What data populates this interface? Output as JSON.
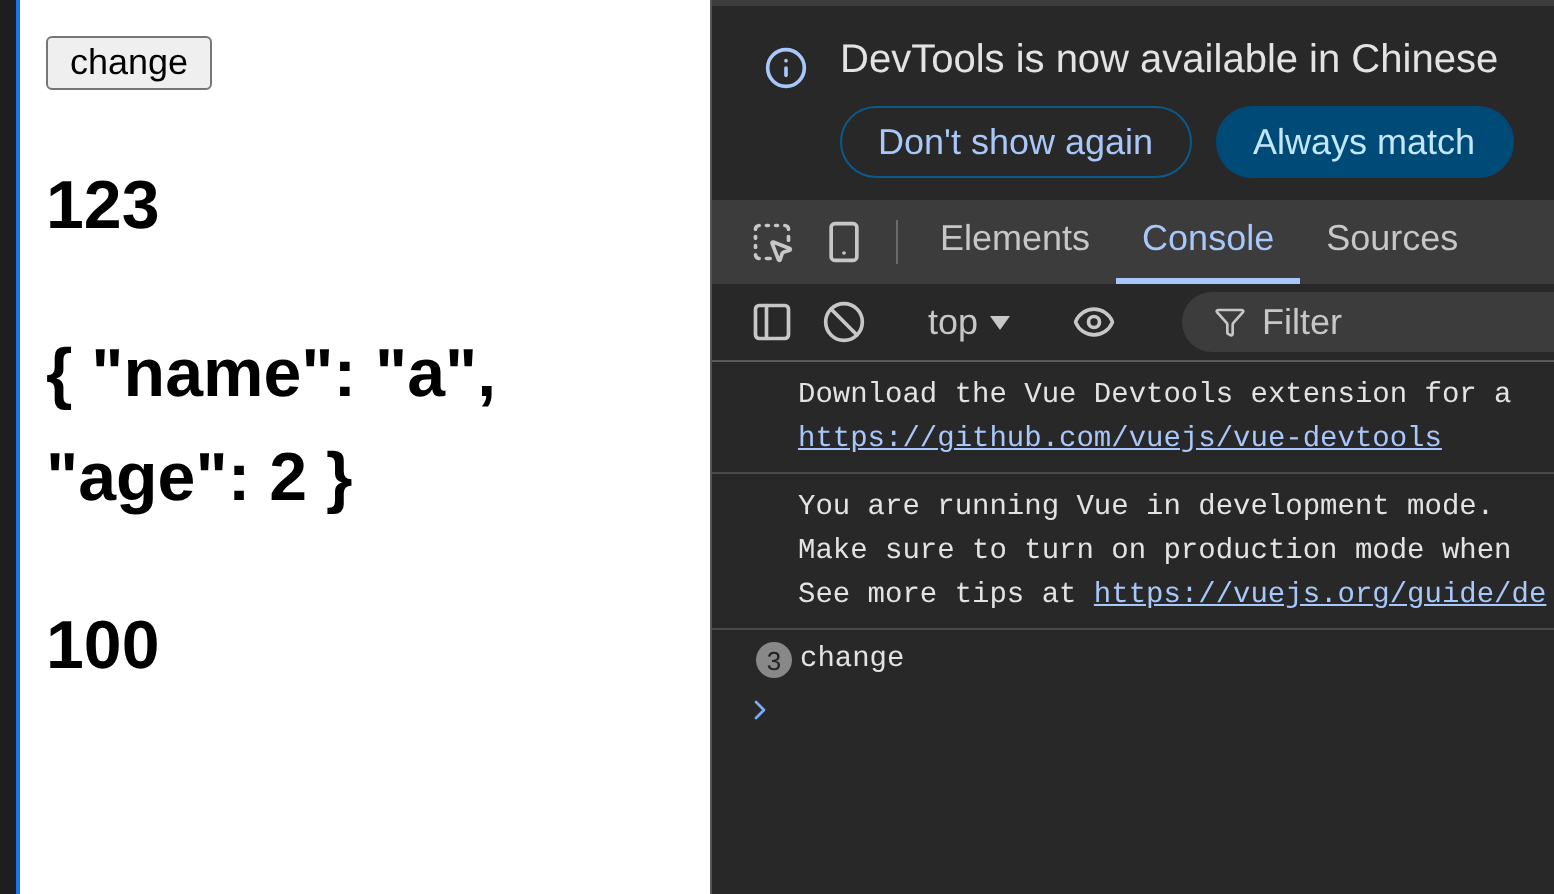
{
  "page": {
    "button": "change",
    "outputs": [
      "123",
      "{ \"name\": \"a\", \"age\": 2 }",
      "100"
    ]
  },
  "devtools": {
    "banner": {
      "text": "DevTools is now available in Chinese",
      "buttons": [
        {
          "label": "Don't show again",
          "kind": "outline"
        },
        {
          "label": "Always match",
          "kind": "primary"
        }
      ]
    },
    "tabs": [
      {
        "label": "Elements",
        "selected": false
      },
      {
        "label": "Console",
        "selected": true
      },
      {
        "label": "Sources",
        "selected": false
      }
    ],
    "toolbar": {
      "context": "top",
      "filter": {
        "placeholder": "Filter"
      }
    },
    "messages": [
      {
        "kind": "log",
        "lines": [
          {
            "text": "Download the Vue Devtools extension for a"
          },
          {
            "link": "https://github.com/vuejs/vue-devtools"
          }
        ]
      },
      {
        "kind": "log",
        "lines": [
          {
            "text": "You are running Vue in development mode."
          },
          {
            "text": "Make sure to turn on production mode when"
          },
          {
            "text": "See more tips at",
            "link": "https://vuejs.org/guide/de"
          }
        ]
      },
      {
        "kind": "repeat",
        "count": "3",
        "lines": [
          {
            "text": "change"
          }
        ]
      }
    ]
  }
}
